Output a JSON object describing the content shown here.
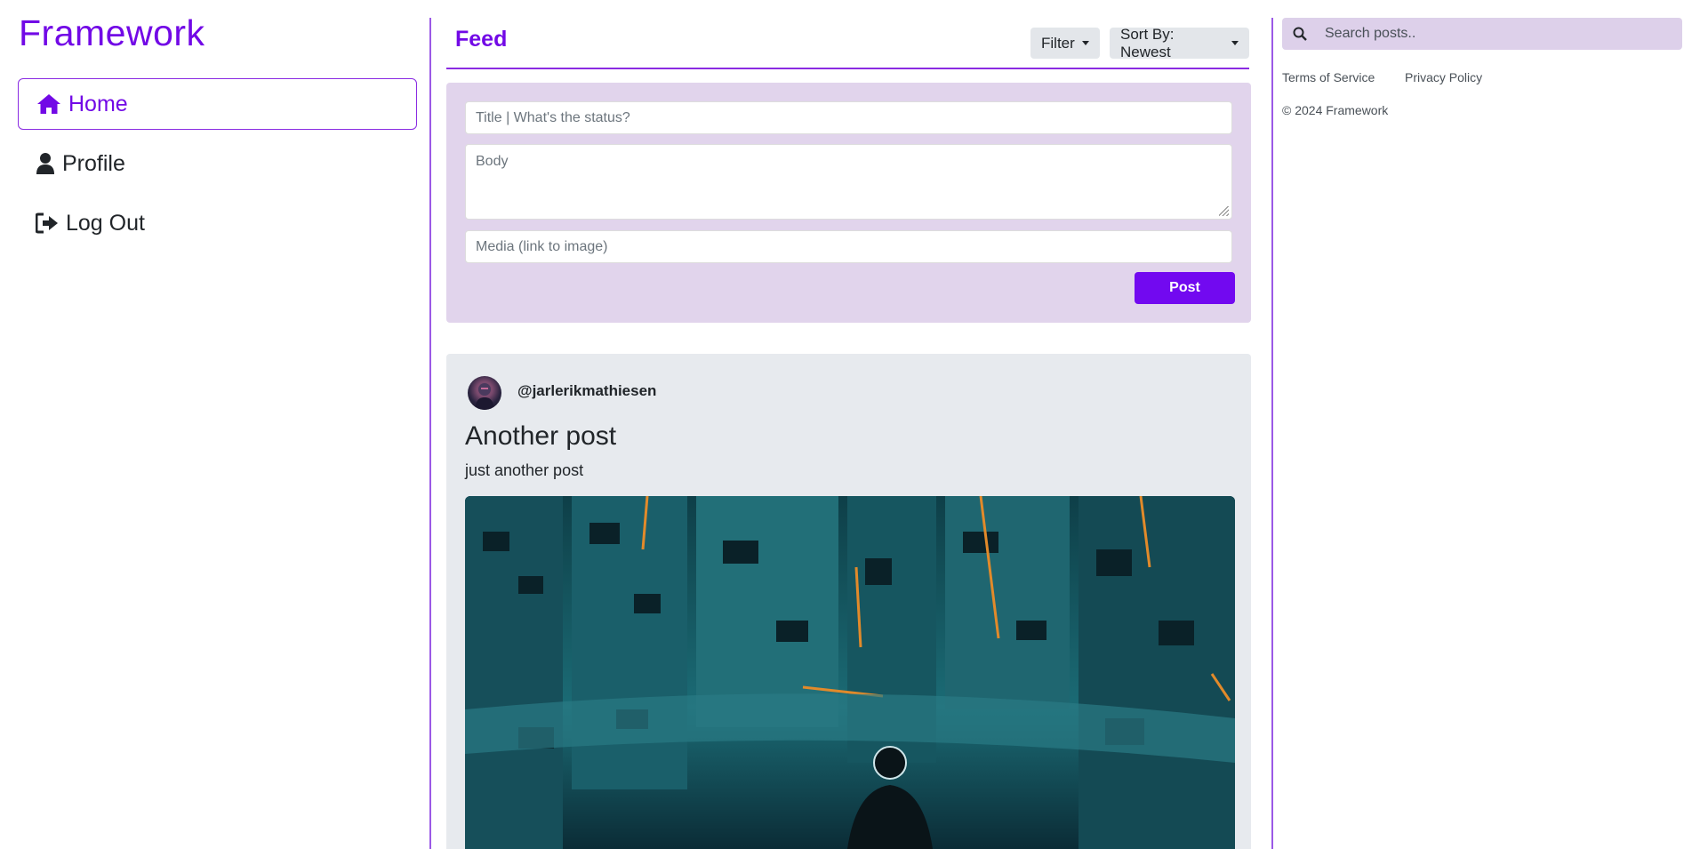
{
  "app": {
    "brand": "Framework"
  },
  "nav": {
    "items": [
      {
        "label": "Home",
        "icon": "home-icon",
        "active": true
      },
      {
        "label": "Profile",
        "icon": "user-icon",
        "active": false
      },
      {
        "label": "Log Out",
        "icon": "logout-icon",
        "active": false
      }
    ]
  },
  "feed": {
    "title": "Feed",
    "filter_label": "Filter",
    "sort_label": "Sort By: Newest"
  },
  "composer": {
    "title_placeholder": "Title | What's the status?",
    "body_placeholder": "Body",
    "media_placeholder": "Media (link to image)",
    "post_label": "Post"
  },
  "posts": [
    {
      "handle": "@jarlerikmathiesen",
      "title": "Another post",
      "body": "just another post"
    }
  ],
  "search": {
    "placeholder": "Search posts.."
  },
  "footer": {
    "terms": "Terms of Service",
    "privacy": "Privacy Policy",
    "copyright": "© 2024 Framework"
  },
  "colors": {
    "accent": "#7209e6",
    "composer_bg": "#e1d4ec",
    "card_bg": "#e7eaee",
    "search_bg": "#ddd0ea"
  }
}
